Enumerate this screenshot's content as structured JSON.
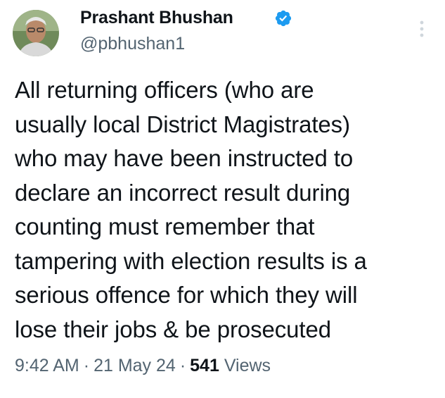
{
  "author": {
    "name": "Prashant Bhushan",
    "handle": "@pbhushan1",
    "verified": true,
    "verified_color": "#1d9bf0"
  },
  "tweet": {
    "lines": [
      "All returning officers (who are",
      "usually local District Magistrates)",
      "who may have been instructed to",
      "declare an incorrect result during",
      "counting must remember that",
      "tampering with election results is a",
      "serious offence for which they will",
      "lose their jobs & be prosecuted"
    ]
  },
  "meta": {
    "time": "9:42 AM",
    "separator": "·",
    "date": "21 May 24",
    "views_count": "541",
    "views_label": "Views"
  },
  "icons": {
    "verified": "verified-badge-icon",
    "more": "more-vertical-icon"
  }
}
